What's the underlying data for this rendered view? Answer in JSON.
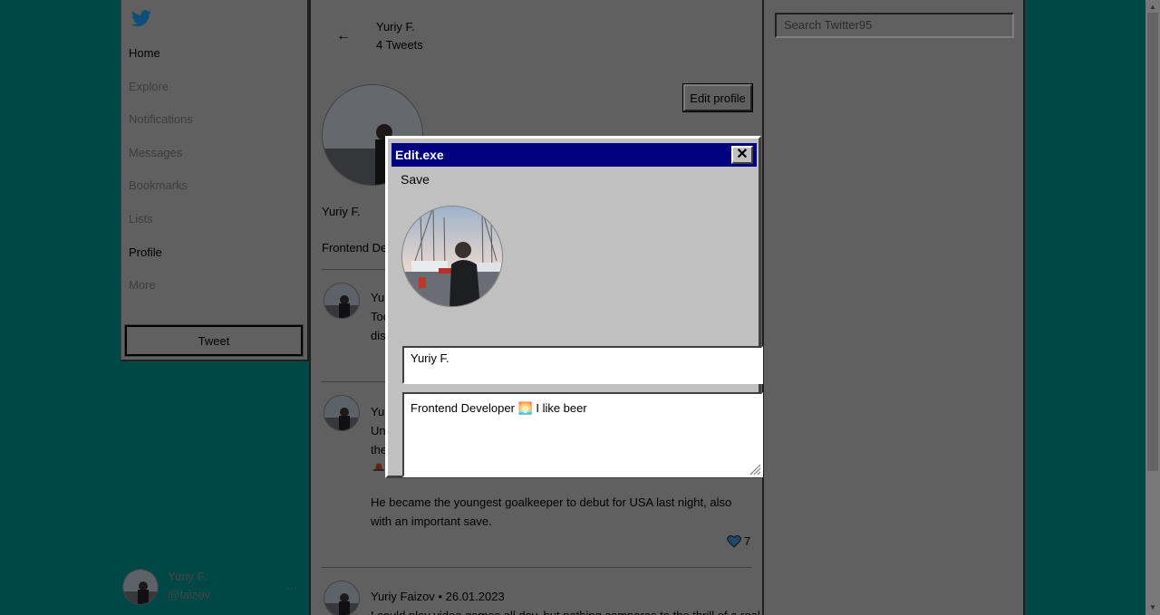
{
  "sidebar": {
    "nav": [
      {
        "label": "Home"
      },
      {
        "label": "Explore"
      },
      {
        "label": "Notifications"
      },
      {
        "label": "Messages"
      },
      {
        "label": "Bookmarks"
      },
      {
        "label": "Lists"
      },
      {
        "label": "Profile"
      },
      {
        "label": "More"
      }
    ],
    "tweet_button": "Tweet"
  },
  "account": {
    "name": "Yuriy F.",
    "handle": "@faizov",
    "more": "..."
  },
  "profile_header": {
    "back": "←",
    "name": "Yuriy F.",
    "tweet_count": "4 Tweets",
    "edit_button": "Edit profile"
  },
  "profile": {
    "name": "Yuriy F.",
    "bio_partial": "Frontend De"
  },
  "tweets": [
    {
      "text_partial": [
        "Yu",
        "Toc",
        "dis"
      ]
    },
    {
      "text_partial": [
        "Yu",
        "Unc",
        "the"
      ],
      "body": "He became the youngest goalkeeper to debut for USA last night, also with an important save.",
      "likes": "7"
    },
    {
      "author": "Yuriy Faizov",
      "separator": "•",
      "date": "26.01.2023",
      "text_partial": "I could play video games all day, but nothing compares to the thrill of a real"
    }
  ],
  "search": {
    "placeholder": "Search Twitter95"
  },
  "dialog": {
    "title": "Edit.exe",
    "save_label": "Save",
    "close_label": "✕",
    "name_value": "Yuriy F.",
    "bio_text": "Frontend Developer",
    "bio_emoji": "🌅",
    "bio_suffix": "I like beer"
  },
  "colors": {
    "desktop": "#004747",
    "titlebar": "#000080",
    "window": "#c0c0c0"
  }
}
